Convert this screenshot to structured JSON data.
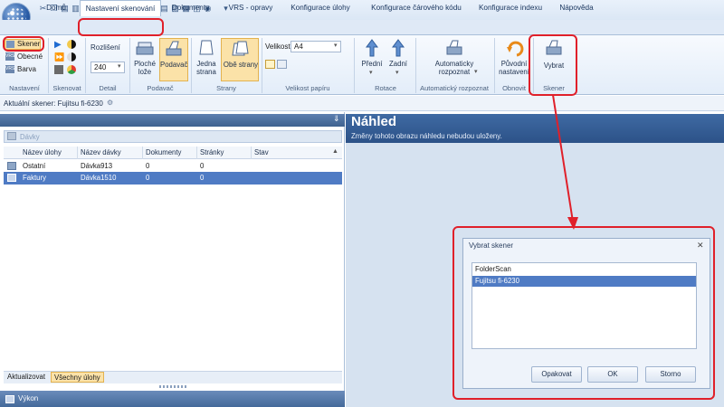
{
  "tabs": [
    {
      "label": "Domů"
    },
    {
      "label": "Nastavení skenování"
    },
    {
      "label": "Dokumenty"
    },
    {
      "label": "VRS - opravy"
    },
    {
      "label": "Konfigurace úlohy"
    },
    {
      "label": "Konfigurace čárového kódu"
    },
    {
      "label": "Konfigurace indexu"
    },
    {
      "label": "Nápověda"
    }
  ],
  "ribbon": {
    "nastaveni": {
      "skener": "Skener",
      "obecne": "Obecné",
      "barva": "Barva",
      "group": "Nastavení"
    },
    "skenovat": {
      "group": "Skenovat"
    },
    "detail": {
      "rozliseni": "Rozlišení",
      "rozliseni_value": "240",
      "group": "Detail"
    },
    "podavac": {
      "ploche": "Ploché",
      "loze": "lože",
      "podavac": "Podavač",
      "group": "Podavač"
    },
    "strany": {
      "jedna": "Jedna",
      "strana": "strana",
      "obe": "Obě strany",
      "group": "Strany"
    },
    "velikost": {
      "label": "Velikost",
      "value": "A4",
      "group": "Velikost papíru"
    },
    "rotace": {
      "predni": "Přední",
      "zadni": "Zadní",
      "group": "Rotace"
    },
    "auto": {
      "line1": "Automaticky",
      "line2": "rozpoznat",
      "group": "Automatický rozpoznat"
    },
    "obnovit": {
      "line1": "Původní",
      "line2": "nastavení",
      "group": "Obnovit"
    },
    "skener": {
      "vybrat": "Vybrat",
      "group": "Skener"
    }
  },
  "infobar": {
    "text": "Aktuální skener: Fujitsu fi-6230"
  },
  "left": {
    "section_title": "Dávky",
    "columns": [
      "Název úlohy",
      "Název dávky",
      "Dokumenty",
      "Stránky",
      "Stav"
    ],
    "rows": [
      {
        "job": "Ostatní",
        "batch": "Dávka913",
        "docs": "0",
        "pages": "0",
        "state": ""
      },
      {
        "job": "Faktury",
        "batch": "Dávka1510",
        "docs": "0",
        "pages": "0",
        "state": ""
      }
    ],
    "footer": {
      "refresh": "Aktualizovat",
      "all_jobs": "Všechny úlohy"
    },
    "vykon": "Výkon"
  },
  "preview": {
    "title": "Náhled",
    "subtitle": "Změny tohoto obrazu náhledu nebudou uloženy."
  },
  "dialog": {
    "title": "Vybrat skener",
    "items": [
      "FolderScan",
      "Fujitsu fi-6230"
    ],
    "selected_index": 1,
    "buttons": {
      "opakovat": "Opakovat",
      "ok": "OK",
      "storno": "Storno"
    }
  },
  "colors": {
    "accent": "#2c5288",
    "selection": "#4f7bc4",
    "highlight": "#e0202a"
  }
}
